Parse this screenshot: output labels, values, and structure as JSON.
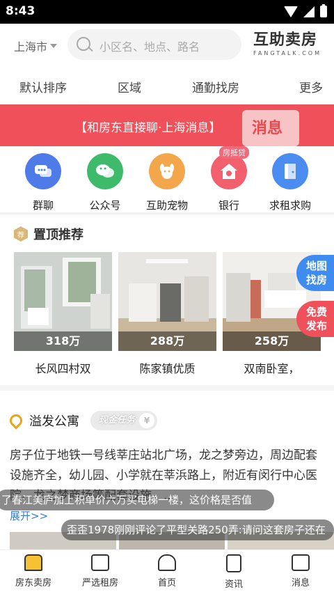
{
  "status": {
    "time": "8:43"
  },
  "header": {
    "city": "上海市",
    "search_placeholder": "小区名、地点、路名",
    "logo_main": "互助卖房",
    "logo_sub": "FANGTALK.COM"
  },
  "filter_tabs": [
    "默认排序",
    "区域",
    "通勤找房",
    "更多"
  ],
  "banner": {
    "text": "【和房东直接聊·上海消息】",
    "badge": "消息"
  },
  "quick_links": [
    {
      "label": "群聊",
      "icon": "chat-group-icon",
      "color": "#4f7be9"
    },
    {
      "label": "公众号",
      "icon": "wechat-icon",
      "color": "#3dbb6a"
    },
    {
      "label": "互助宠物",
      "icon": "dog-icon",
      "color": "#f3a64a"
    },
    {
      "label": "银行",
      "icon": "bank-house-icon",
      "color": "#f2606d",
      "badge": "房抵贷"
    },
    {
      "label": "求租求购",
      "icon": "door-icon",
      "color": "#4b8cf0"
    }
  ],
  "recommend": {
    "title": "置顶推荐",
    "icon_text": "荐",
    "items": [
      {
        "price": "318万",
        "name": "长风四村双"
      },
      {
        "price": "288万",
        "name": "陈家镇优质"
      },
      {
        "price": "258万",
        "name": "双南卧室，"
      }
    ]
  },
  "float_buttons": {
    "map": "地图找房",
    "publish": "免费发布"
  },
  "post": {
    "author": "溢发公寓",
    "task_badge": "现金任务",
    "task_yen": "¥",
    "body": "房子位于地铁一号线莘庄站北广场，龙之梦旁边，周边配套设施齐全，幼儿园、小学就在莘浜路上，附近有闵行中心医院、龙之梦商场等配套设施，...",
    "more": "展开>>"
  },
  "toasts": [
    "了春江美庐加上积单价六万买电梯一楼，这价格是否值",
    "歪歪1978刚刚评论了平型关路250弄:请问这套房子还在"
  ],
  "bottom_nav": [
    {
      "label": "房东卖房",
      "icon": "house-icon",
      "active": true
    },
    {
      "label": "严选租房",
      "icon": "home-outline-icon"
    },
    {
      "label": "首页",
      "icon": "home-main-icon"
    },
    {
      "label": "资讯",
      "icon": "news-icon"
    },
    {
      "label": "消息",
      "icon": "message-icon"
    }
  ],
  "colors": {
    "banner": "#f0505a",
    "map_button": "#3f8cf0",
    "publish_button": "#f0505a",
    "accent": "#f5c235"
  }
}
